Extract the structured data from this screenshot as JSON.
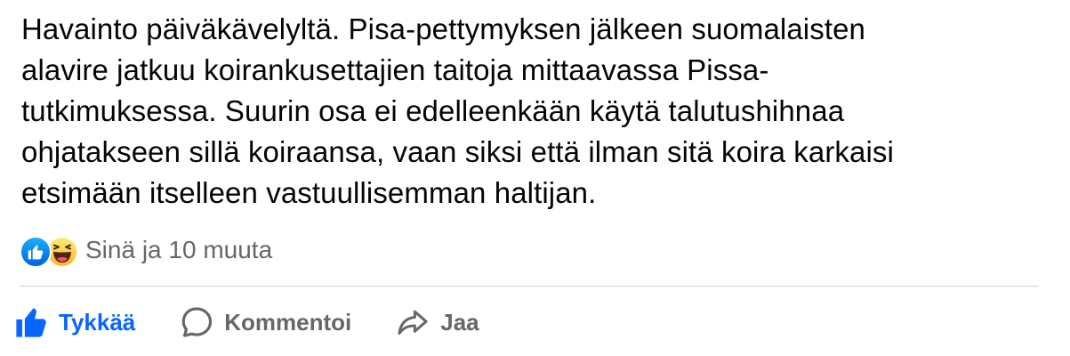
{
  "post": {
    "text": "Havainto päiväkävelyltä. Pisa-pettymyksen jälkeen  suomalaisten\nalavire jatkuu koirankusettajien taitoja mittaavassa Pissa-\ntutkimuksessa. Suurin osa ei edelleenkään käytä talutushihnaa\nohjatakseen sillä koiraansa, vaan siksi että ilman sitä koira karkaisi\netsimään itselleen vastuullisemman haltijan."
  },
  "reactions": {
    "icons": [
      "like-reaction-icon",
      "haha-reaction-icon"
    ],
    "summary": "Sinä ja 10 muuta"
  },
  "actions": {
    "like": {
      "label": "Tykkää",
      "icon": "thumbs-up-icon",
      "active": true
    },
    "comment": {
      "label": "Kommentoi",
      "icon": "comment-bubble-icon"
    },
    "share": {
      "label": "Jaa",
      "icon": "share-arrow-icon"
    }
  },
  "colors": {
    "text": "#050505",
    "secondary_text": "#65676b",
    "like_active": "#0866ff",
    "divider": "#ced0d4",
    "haha_yellow": "#f7b928"
  }
}
